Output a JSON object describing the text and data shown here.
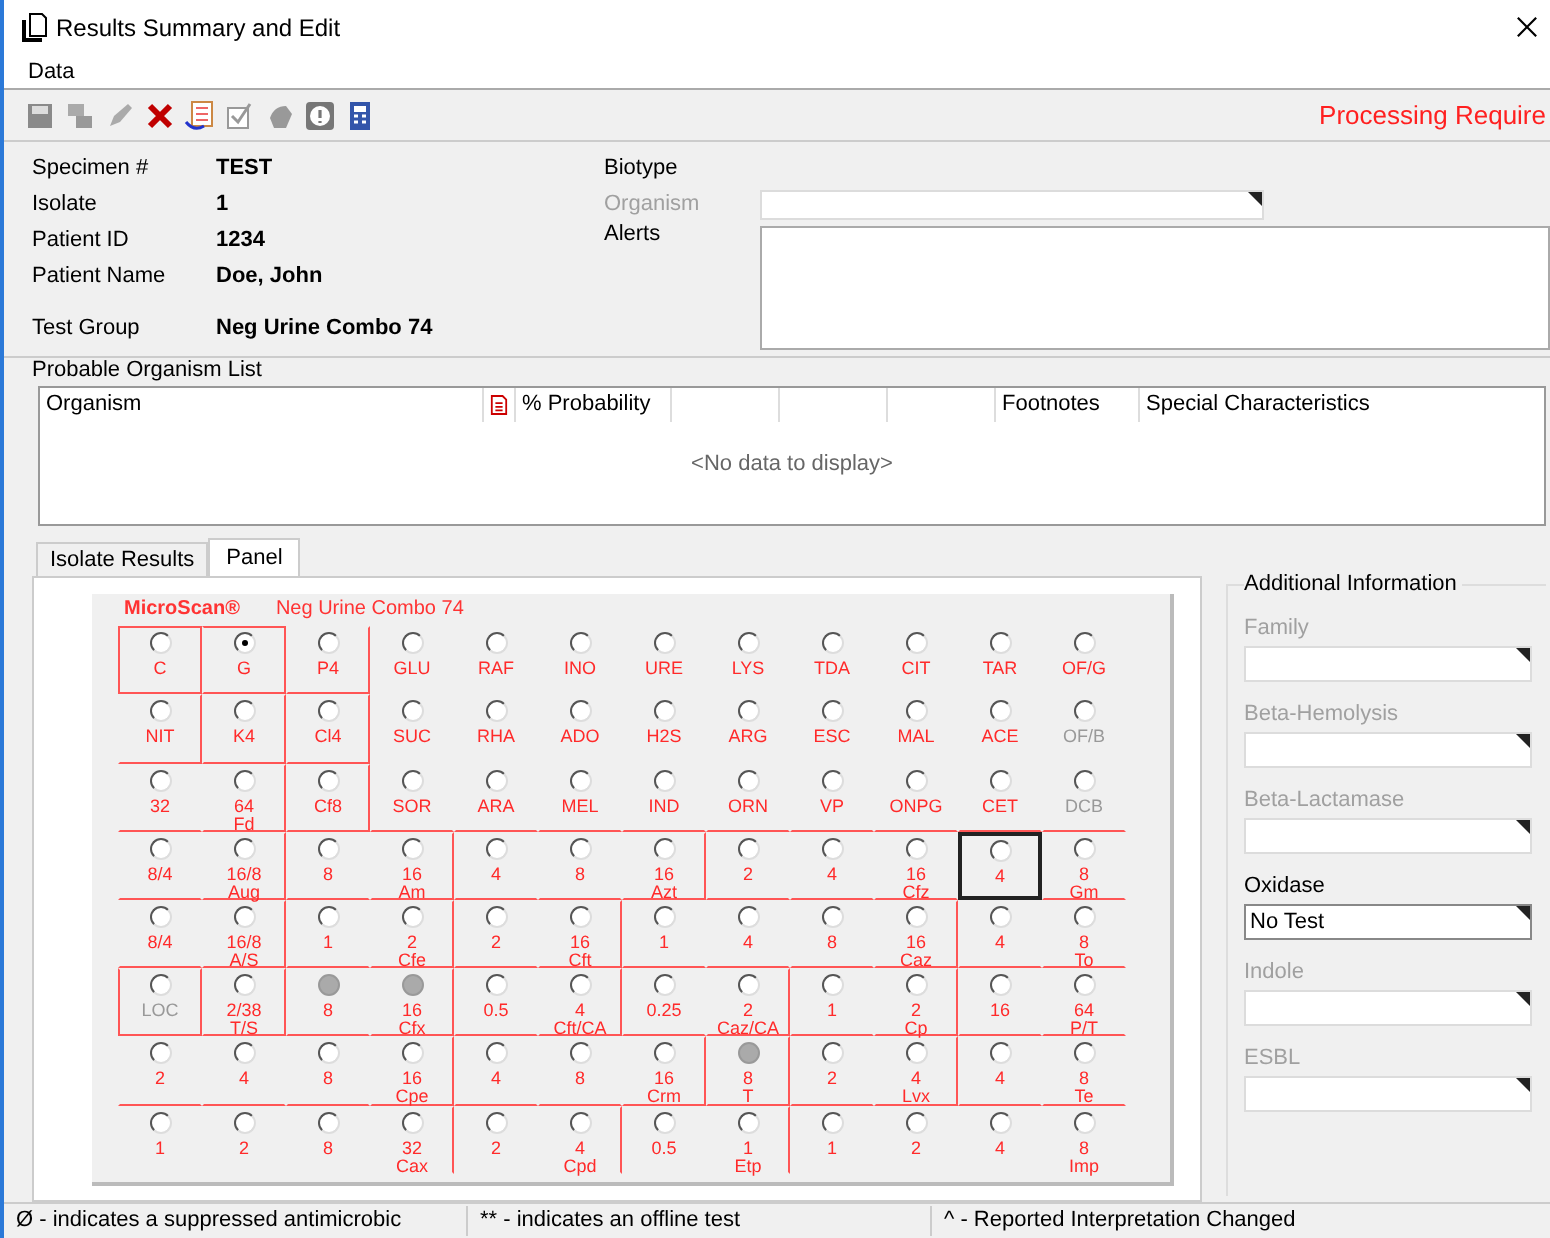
{
  "window": {
    "title": "Results Summary and Edit"
  },
  "menu": [
    "Data"
  ],
  "status_message": "Processing Require",
  "details": [
    {
      "label": "Specimen #",
      "value": "TEST"
    },
    {
      "label": "Isolate",
      "value": "1"
    },
    {
      "label": "Patient ID",
      "value": "1234"
    },
    {
      "label": "Patient Name",
      "value": "Doe, John"
    },
    {
      "label": "Test Group",
      "value": "Neg Urine Combo 74"
    }
  ],
  "biotype": {
    "label": "Biotype",
    "organism_label": "Organism",
    "organism_disabled": true,
    "alerts_label": "Alerts"
  },
  "organism_list": {
    "title": "Probable Organism List",
    "columns": [
      "Organism",
      "% Probability",
      "Footnotes",
      "Special Characteristics"
    ],
    "empty_text": "<No data to display>"
  },
  "tabs": [
    {
      "label": "Isolate Results",
      "selected": false
    },
    {
      "label": "Panel",
      "selected": true
    }
  ],
  "panel": {
    "brand": "MicroScan®",
    "name": "Neg Urine Combo 74",
    "rows": [
      [
        {
          "kind": "plain",
          "label": "C",
          "selected": false,
          "dimmed": false,
          "focused": false
        },
        {
          "kind": "plain",
          "label": "G",
          "selected": true,
          "dimmed": false,
          "focused": false
        },
        {
          "kind": "plain",
          "label": "P4",
          "selected": false,
          "dimmed": false,
          "focused": false
        },
        {
          "kind": "plain",
          "label": "GLU",
          "selected": false,
          "dimmed": false,
          "focused": false
        },
        {
          "kind": "plain",
          "label": "RAF",
          "selected": false,
          "dimmed": false,
          "focused": false
        },
        {
          "kind": "plain",
          "label": "INO",
          "selected": false,
          "dimmed": false,
          "focused": false
        },
        {
          "kind": "plain",
          "label": "URE",
          "selected": false,
          "dimmed": false,
          "focused": false
        },
        {
          "kind": "plain",
          "label": "LYS",
          "selected": false,
          "dimmed": false,
          "focused": false
        },
        {
          "kind": "plain",
          "label": "TDA",
          "selected": false,
          "dimmed": false,
          "focused": false
        },
        {
          "kind": "plain",
          "label": "CIT",
          "selected": false,
          "dimmed": false,
          "focused": false
        },
        {
          "kind": "plain",
          "label": "TAR",
          "selected": false,
          "dimmed": false,
          "focused": false
        },
        {
          "kind": "plain",
          "label": "OF/G",
          "selected": false,
          "dimmed": false,
          "focused": false
        }
      ],
      [
        {
          "kind": "plain",
          "label": "NIT",
          "selected": false,
          "dimmed": false,
          "focused": false
        },
        {
          "kind": "plain",
          "label": "K4",
          "selected": false,
          "dimmed": false,
          "focused": false
        },
        {
          "kind": "plain",
          "label": "Cl4",
          "selected": false,
          "dimmed": false,
          "focused": false
        },
        {
          "kind": "plain",
          "label": "SUC",
          "selected": false,
          "dimmed": false,
          "focused": false
        },
        {
          "kind": "plain",
          "label": "RHA",
          "selected": false,
          "dimmed": false,
          "focused": false
        },
        {
          "kind": "plain",
          "label": "ADO",
          "selected": false,
          "dimmed": false,
          "focused": false
        },
        {
          "kind": "plain",
          "label": "H2S",
          "selected": false,
          "dimmed": false,
          "focused": false
        },
        {
          "kind": "plain",
          "label": "ARG",
          "selected": false,
          "dimmed": false,
          "focused": false
        },
        {
          "kind": "plain",
          "label": "ESC",
          "selected": false,
          "dimmed": false,
          "focused": false
        },
        {
          "kind": "plain",
          "label": "MAL",
          "selected": false,
          "dimmed": false,
          "focused": false
        },
        {
          "kind": "plain",
          "label": "ACE",
          "selected": false,
          "dimmed": false,
          "focused": false
        },
        {
          "kind": "plain",
          "label": "OF/B",
          "selected": false,
          "dimmed": true,
          "focused": false
        }
      ],
      [
        {
          "kind": "plain",
          "label": "32",
          "selected": false,
          "dimmed": false,
          "focused": false
        },
        {
          "kind": "plain",
          "label": "64",
          "sub": "Fd",
          "selected": false,
          "dimmed": false,
          "focused": false
        },
        {
          "kind": "plain",
          "label": "Cf8",
          "selected": false,
          "dimmed": false,
          "focused": false
        },
        {
          "kind": "plain",
          "label": "SOR",
          "selected": false,
          "dimmed": false,
          "focused": false
        },
        {
          "kind": "plain",
          "label": "ARA",
          "selected": false,
          "dimmed": false,
          "focused": false
        },
        {
          "kind": "plain",
          "label": "MEL",
          "selected": false,
          "dimmed": false,
          "focused": false
        },
        {
          "kind": "plain",
          "label": "IND",
          "selected": false,
          "dimmed": false,
          "focused": false
        },
        {
          "kind": "plain",
          "label": "ORN",
          "selected": false,
          "dimmed": false,
          "focused": false
        },
        {
          "kind": "plain",
          "label": "VP",
          "selected": false,
          "dimmed": false,
          "focused": false
        },
        {
          "kind": "plain",
          "label": "ONPG",
          "selected": false,
          "dimmed": false,
          "focused": false
        },
        {
          "kind": "plain",
          "label": "CET",
          "selected": false,
          "dimmed": false,
          "focused": false
        },
        {
          "kind": "plain",
          "label": "DCB",
          "selected": false,
          "dimmed": true,
          "focused": false
        }
      ],
      [
        {
          "kind": "plain",
          "label": "8/4",
          "selected": false,
          "dimmed": false,
          "focused": false
        },
        {
          "kind": "plain",
          "label": "16/8",
          "sub": "Aug",
          "selected": false,
          "dimmed": false,
          "focused": false
        },
        {
          "kind": "plain",
          "label": "8",
          "selected": false,
          "dimmed": false,
          "focused": false
        },
        {
          "kind": "plain",
          "label": "16",
          "sub": "Am",
          "selected": false,
          "dimmed": false,
          "focused": false
        },
        {
          "kind": "plain",
          "label": "4",
          "selected": false,
          "dimmed": false,
          "focused": false
        },
        {
          "kind": "plain",
          "label": "8",
          "selected": false,
          "dimmed": false,
          "focused": false
        },
        {
          "kind": "plain",
          "label": "16",
          "sub": "Azt",
          "selected": false,
          "dimmed": false,
          "focused": false
        },
        {
          "kind": "plain",
          "label": "2",
          "selected": false,
          "dimmed": false,
          "focused": false
        },
        {
          "kind": "plain",
          "label": "4",
          "selected": false,
          "dimmed": false,
          "focused": false
        },
        {
          "kind": "plain",
          "label": "16",
          "sub": "Cfz",
          "selected": false,
          "dimmed": false,
          "focused": false
        },
        {
          "kind": "plain",
          "label": "4",
          "selected": false,
          "dimmed": false,
          "focused": true
        },
        {
          "kind": "plain",
          "label": "8",
          "sub": "Gm",
          "selected": false,
          "dimmed": false,
          "focused": false
        }
      ],
      [
        {
          "kind": "plain",
          "label": "8/4",
          "selected": false,
          "dimmed": false,
          "focused": false
        },
        {
          "kind": "plain",
          "label": "16/8",
          "sub": "A/S",
          "selected": false,
          "dimmed": false,
          "focused": false
        },
        {
          "kind": "plain",
          "label": "1",
          "selected": false,
          "dimmed": false,
          "focused": false
        },
        {
          "kind": "plain",
          "label": "2",
          "sub": "Cfe",
          "selected": false,
          "dimmed": false,
          "focused": false
        },
        {
          "kind": "plain",
          "label": "2",
          "selected": false,
          "dimmed": false,
          "focused": false
        },
        {
          "kind": "plain",
          "label": "16",
          "sub": "Cft",
          "selected": false,
          "dimmed": false,
          "focused": false
        },
        {
          "kind": "plain",
          "label": "1",
          "selected": false,
          "dimmed": false,
          "focused": false
        },
        {
          "kind": "plain",
          "label": "4",
          "selected": false,
          "dimmed": false,
          "focused": false
        },
        {
          "kind": "plain",
          "label": "8",
          "selected": false,
          "dimmed": false,
          "focused": false
        },
        {
          "kind": "plain",
          "label": "16",
          "sub": "Caz",
          "selected": false,
          "dimmed": false,
          "focused": false
        },
        {
          "kind": "plain",
          "label": "4",
          "selected": false,
          "dimmed": false,
          "focused": false
        },
        {
          "kind": "plain",
          "label": "8",
          "sub": "To",
          "selected": false,
          "dimmed": false,
          "focused": false
        }
      ],
      [
        {
          "kind": "plain",
          "label": "LOC",
          "selected": false,
          "dimmed": true,
          "focused": false
        },
        {
          "kind": "plain",
          "label": "2/38",
          "sub": "T/S",
          "selected": false,
          "dimmed": false,
          "focused": false
        },
        {
          "kind": "shaded",
          "label": "8",
          "selected": false,
          "dimmed": false,
          "focused": false
        },
        {
          "kind": "shaded",
          "label": "16",
          "sub": "Cfx",
          "selected": false,
          "dimmed": false,
          "focused": false
        },
        {
          "kind": "plain",
          "label": "0.5",
          "selected": false,
          "dimmed": false,
          "focused": false
        },
        {
          "kind": "plain",
          "label": "4",
          "sub": "Cft/CA",
          "selected": false,
          "dimmed": false,
          "focused": false
        },
        {
          "kind": "plain",
          "label": "0.25",
          "selected": false,
          "dimmed": false,
          "focused": false
        },
        {
          "kind": "plain",
          "label": "2",
          "sub": "Caz/CA",
          "selected": false,
          "dimmed": false,
          "focused": false
        },
        {
          "kind": "plain",
          "label": "1",
          "selected": false,
          "dimmed": false,
          "focused": false
        },
        {
          "kind": "plain",
          "label": "2",
          "sub": "Cp",
          "selected": false,
          "dimmed": false,
          "focused": false
        },
        {
          "kind": "plain",
          "label": "16",
          "selected": false,
          "dimmed": false,
          "focused": false
        },
        {
          "kind": "plain",
          "label": "64",
          "sub": "P/T",
          "selected": false,
          "dimmed": false,
          "focused": false
        }
      ],
      [
        {
          "kind": "plain",
          "label": "2",
          "selected": false,
          "dimmed": false,
          "focused": false
        },
        {
          "kind": "plain",
          "label": "4",
          "selected": false,
          "dimmed": false,
          "focused": false
        },
        {
          "kind": "plain",
          "label": "8",
          "selected": false,
          "dimmed": false,
          "focused": false
        },
        {
          "kind": "plain",
          "label": "16",
          "sub": "Cpe",
          "selected": false,
          "dimmed": false,
          "focused": false
        },
        {
          "kind": "plain",
          "label": "4",
          "selected": false,
          "dimmed": false,
          "focused": false
        },
        {
          "kind": "plain",
          "label": "8",
          "selected": false,
          "dimmed": false,
          "focused": false
        },
        {
          "kind": "plain",
          "label": "16",
          "sub": "Crm",
          "selected": false,
          "dimmed": false,
          "focused": false
        },
        {
          "kind": "shaded",
          "label": "8",
          "sub": "T",
          "selected": false,
          "dimmed": false,
          "focused": false
        },
        {
          "kind": "plain",
          "label": "2",
          "selected": false,
          "dimmed": false,
          "focused": false
        },
        {
          "kind": "plain",
          "label": "4",
          "sub": "Lvx",
          "selected": false,
          "dimmed": false,
          "focused": false
        },
        {
          "kind": "plain",
          "label": "4",
          "selected": false,
          "dimmed": false,
          "focused": false
        },
        {
          "kind": "plain",
          "label": "8",
          "sub": "Te",
          "selected": false,
          "dimmed": false,
          "focused": false
        }
      ],
      [
        {
          "kind": "plain",
          "label": "1",
          "selected": false,
          "dimmed": false,
          "focused": false
        },
        {
          "kind": "plain",
          "label": "2",
          "selected": false,
          "dimmed": false,
          "focused": false
        },
        {
          "kind": "plain",
          "label": "8",
          "selected": false,
          "dimmed": false,
          "focused": false
        },
        {
          "kind": "plain",
          "label": "32",
          "sub": "Cax",
          "selected": false,
          "dimmed": false,
          "focused": false
        },
        {
          "kind": "plain",
          "label": "2",
          "selected": false,
          "dimmed": false,
          "focused": false
        },
        {
          "kind": "plain",
          "label": "4",
          "sub": "Cpd",
          "selected": false,
          "dimmed": false,
          "focused": false
        },
        {
          "kind": "plain",
          "label": "0.5",
          "selected": false,
          "dimmed": false,
          "focused": false
        },
        {
          "kind": "plain",
          "label": "1",
          "sub": "Etp",
          "selected": false,
          "dimmed": false,
          "focused": false
        },
        {
          "kind": "plain",
          "label": "1",
          "selected": false,
          "dimmed": false,
          "focused": false
        },
        {
          "kind": "plain",
          "label": "2",
          "selected": false,
          "dimmed": false,
          "focused": false
        },
        {
          "kind": "plain",
          "label": "4",
          "selected": false,
          "dimmed": false,
          "focused": false
        },
        {
          "kind": "plain",
          "label": "8",
          "sub": "Imp",
          "selected": false,
          "dimmed": false,
          "focused": false
        }
      ]
    ]
  },
  "additional_info": {
    "title": "Additional Information",
    "fields": [
      {
        "label": "Family",
        "disabled": true
      },
      {
        "label": "Beta-Hemolysis",
        "disabled": true
      },
      {
        "label": "Beta-Lactamase",
        "disabled": true
      },
      {
        "label": "Oxidase",
        "value": "No Test",
        "disabled": false
      },
      {
        "label": "Indole",
        "disabled": true
      },
      {
        "label": "ESBL",
        "disabled": true
      }
    ]
  },
  "status_bar": [
    "Ø - indicates a suppressed antimicrobic",
    "** - indicates an offline test",
    "^ - Reported Interpretation Changed"
  ]
}
